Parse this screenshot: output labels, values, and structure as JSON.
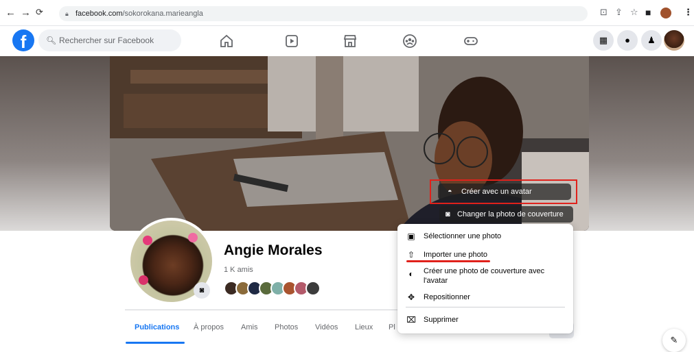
{
  "browser": {
    "url_domain": "facebook.com",
    "url_path": "/sokorokana.marieangla"
  },
  "fb_header": {
    "logo_letter": "f",
    "search_placeholder": "Rechercher sur Facebook"
  },
  "cover": {
    "avatar_button_label": "Créer avec un avatar",
    "change_cover_button_label": "Changer la photo de couverture"
  },
  "profile": {
    "name": "Angie Morales",
    "friends_count": "1 K amis"
  },
  "tabs": [
    {
      "label": "Publications",
      "active": true
    },
    {
      "label": "À propos"
    },
    {
      "label": "Amis"
    },
    {
      "label": "Photos"
    },
    {
      "label": "Vidéos"
    },
    {
      "label": "Lieux"
    },
    {
      "label": "Pl"
    }
  ],
  "cover_menu": {
    "items": [
      {
        "icon": "photo-select-icon",
        "label": "Sélectionner une photo"
      },
      {
        "icon": "upload-icon",
        "label": "Importer une photo"
      },
      {
        "icon": "avatar-icon",
        "label": "Créer une photo de couverture avec",
        "label_line2": "l'avatar"
      },
      {
        "icon": "move-icon",
        "label": "Repositionner"
      },
      {
        "icon": "trash-icon",
        "label": "Supprimer"
      }
    ]
  },
  "colors": {
    "brand": "#1877f2",
    "annotation_red": "#e0211b"
  }
}
